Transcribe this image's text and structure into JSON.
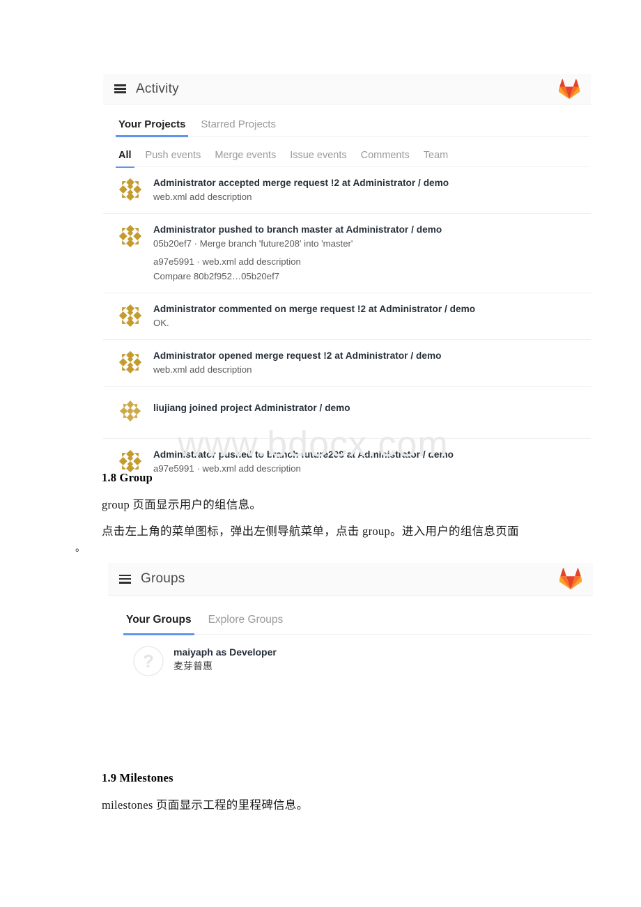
{
  "document": {
    "watermark": "www.bdocx.com",
    "sections": [
      {
        "heading": "1.8 Group",
        "paragraphs": [
          "group 页面显示用户的组信息。",
          "点击左上角的菜单图标，弹出左侧导航菜单，点击 group。进入用户的组信息页面",
          "。"
        ]
      },
      {
        "heading": "1.9 Milestones",
        "paragraphs": [
          "milestones 页面显示工程的里程碑信息。"
        ]
      }
    ]
  },
  "activity_panel": {
    "header": {
      "menu_icon": "hamburger-icon",
      "title": "Activity",
      "logo_icon": "gitlab-logo-icon"
    },
    "primary_tabs": [
      {
        "label": "Your Projects",
        "active": true
      },
      {
        "label": "Starred Projects",
        "active": false
      }
    ],
    "secondary_tabs": [
      {
        "label": "All",
        "active": true
      },
      {
        "label": "Push events",
        "active": false
      },
      {
        "label": "Merge events",
        "active": false
      },
      {
        "label": "Issue events",
        "active": false
      },
      {
        "label": "Comments",
        "active": false
      },
      {
        "label": "Team",
        "active": false
      }
    ],
    "events": [
      {
        "avatar": "identicon-administrator",
        "title": "Administrator accepted merge request !2 at Administrator / demo",
        "lines": [
          "web.xml add description"
        ]
      },
      {
        "avatar": "identicon-administrator",
        "title": "Administrator pushed to branch master at Administrator / demo",
        "lines": [
          "05b20ef7 · Merge branch 'future208' into 'master'",
          "a97e5991 · web.xml add description",
          "Compare 80b2f952…05b20ef7"
        ]
      },
      {
        "avatar": "identicon-administrator",
        "title": "Administrator commented on merge request !2 at Administrator / demo",
        "lines": [
          "OK."
        ]
      },
      {
        "avatar": "identicon-administrator",
        "title": "Administrator opened merge request !2 at Administrator / demo",
        "lines": [
          "web.xml add description"
        ]
      },
      {
        "avatar": "identicon-liujiang",
        "title": "liujiang joined project Administrator / demo",
        "lines": []
      },
      {
        "avatar": "identicon-administrator",
        "title": "Administrator pushed to branch future208 at Administrator / demo",
        "lines": [
          "a97e5991 · web.xml add description"
        ]
      }
    ]
  },
  "groups_panel": {
    "header": {
      "menu_icon": "hamburger-icon",
      "title": "Groups",
      "logo_icon": "gitlab-logo-icon"
    },
    "primary_tabs": [
      {
        "label": "Your Groups",
        "active": true
      },
      {
        "label": "Explore Groups",
        "active": false
      }
    ],
    "groups": [
      {
        "avatar": "question-mark-placeholder-icon",
        "name": "maiyaph as Developer",
        "description": "麦芽普惠"
      }
    ]
  },
  "colors": {
    "accent_blue": "#6195ed",
    "header_bg": "#fafafa",
    "border": "#efefef",
    "title_text": "#26303a",
    "muted_text": "#9a9a9a",
    "logo_red": "#e24329",
    "logo_orange": "#fc6d26",
    "logo_amber": "#fca326",
    "identicon_gold": "#c49b2e",
    "watermark": "#e9e9e9"
  }
}
